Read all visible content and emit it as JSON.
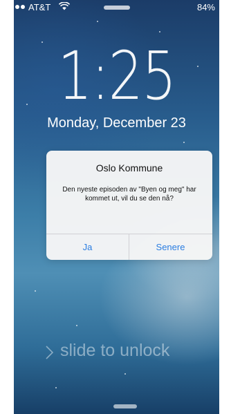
{
  "status_bar": {
    "carrier": "AT&T",
    "battery": "84%",
    "icons": [
      "signal-dots-icon",
      "wifi-icon"
    ]
  },
  "lock_screen": {
    "time": "1:25",
    "date": "Monday, December 23",
    "slide_text": "slide to unlock"
  },
  "alert": {
    "title": "Oslo Kommune",
    "message": "Den nyeste episoden av \"Byen og meg\" har kommet ut, vil du se den nå?",
    "buttons": {
      "left": "Ja",
      "right": "Senere"
    },
    "button_color": "#2a7de1"
  }
}
